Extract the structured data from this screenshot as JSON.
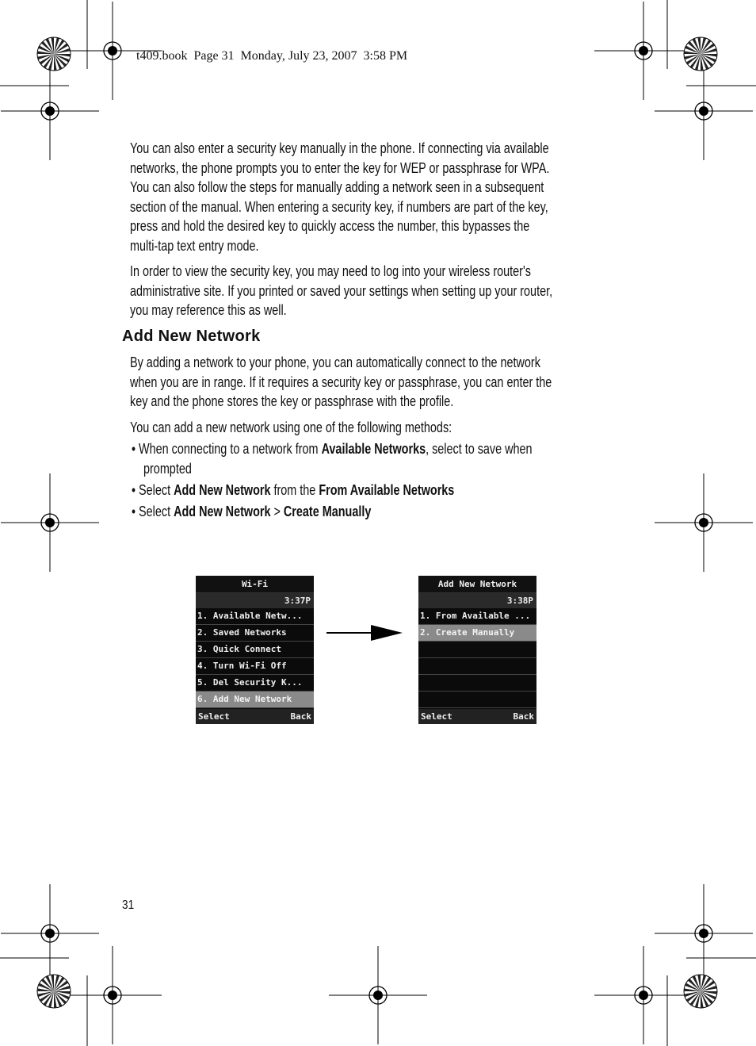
{
  "header": "t409.book  Page 31  Monday, July 23, 2007  3:58 PM",
  "para1": [
    "You can also enter a security key manually in the phone. If connecting via available",
    "networks, the phone prompts you to enter the key for WEP or passphrase for WPA.",
    "You can also follow the steps for manually adding a network seen in a subsequent",
    "section of the manual. When entering a security key, if numbers are part of the key,",
    "press and hold the desired key to quickly access the number, this bypasses the",
    "multi-tap text entry mode."
  ],
  "para2": [
    "In order to view the security key, you may need to log into your wireless router's",
    "administrative site. If you printed or saved your settings when setting up your router,",
    "you may reference this as well."
  ],
  "heading": "Add New Network",
  "para3": [
    "By adding a network to your phone, you can automatically connect to the network",
    "when you are in range. If it requires a security key or passphrase, you can enter the",
    "key and the phone stores the key or passphrase with the profile."
  ],
  "para4": "You can add a new network using one of the following methods:",
  "bullets": [
    {
      "a": "• When connecting to a network from ",
      "b": "Available Networks",
      "c": ", select to save when",
      "d": "",
      "e": ""
    },
    {
      "a": "prompted",
      "b": "",
      "c": "",
      "d": "",
      "e": ""
    },
    {
      "a": "• Select ",
      "b": "Add New Network",
      "c": " from the ",
      "d": "From Available Networks",
      "e": ""
    },
    {
      "a": "• Select ",
      "b": "Add New Network",
      "c": " > ",
      "d": "Create Manually",
      "e": ""
    }
  ],
  "screen1": {
    "title": "Wi-Fi",
    "time": "3:37P",
    "items": [
      "1.  Available Netw...",
      "2.  Saved Networks",
      "3.  Quick Connect",
      "4.  Turn Wi-Fi Off",
      "5.  Del Security K...",
      "6.  Add New Network"
    ],
    "selected": 5,
    "left": "Select",
    "right": "Back"
  },
  "screen2": {
    "title": "Add New Network",
    "time": "3:38P",
    "items": [
      "1.  From Available ...",
      "2.  Create Manually",
      "",
      "",
      "",
      ""
    ],
    "selected": 1,
    "left": "Select",
    "right": "Back"
  },
  "page_number": "31"
}
